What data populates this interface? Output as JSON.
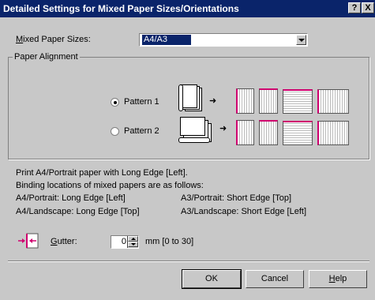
{
  "window": {
    "title": "Detailed Settings for Mixed Paper Sizes/Orientations",
    "help_btn": "?",
    "close_btn": "X"
  },
  "mixed": {
    "label_pre": "",
    "label_u": "M",
    "label_post": "ixed Paper Sizes:",
    "value": "A4/A3"
  },
  "alignment": {
    "title": "Paper Alignment",
    "pattern1": "Pattern 1",
    "pattern2": "Pattern 2",
    "selected": "Pattern 1"
  },
  "info": {
    "line1": "Print A4/Portrait paper with Long Edge [Left].",
    "line2": "Binding locations of mixed papers are as follows:",
    "a4p": "A4/Portrait: Long Edge [Left]",
    "a3p": "A3/Portrait: Short Edge [Top]",
    "a4l": "A4/Landscape: Long Edge [Top]",
    "a3l": "A3/Landscape: Short Edge [Left]"
  },
  "gutter": {
    "label_u": "G",
    "label_post": "utter:",
    "value": "0",
    "unit": "mm [0 to 30]"
  },
  "buttons": {
    "ok": "OK",
    "cancel": "Cancel",
    "help_u": "H",
    "help_post": "elp"
  },
  "icons": {
    "gutter": "gutter-arrows-icon",
    "arrow": "right-arrow-icon"
  },
  "colors": {
    "titlebar": "#0a246a",
    "binding": "#d0006f",
    "dialog": "#c8c8c8"
  }
}
